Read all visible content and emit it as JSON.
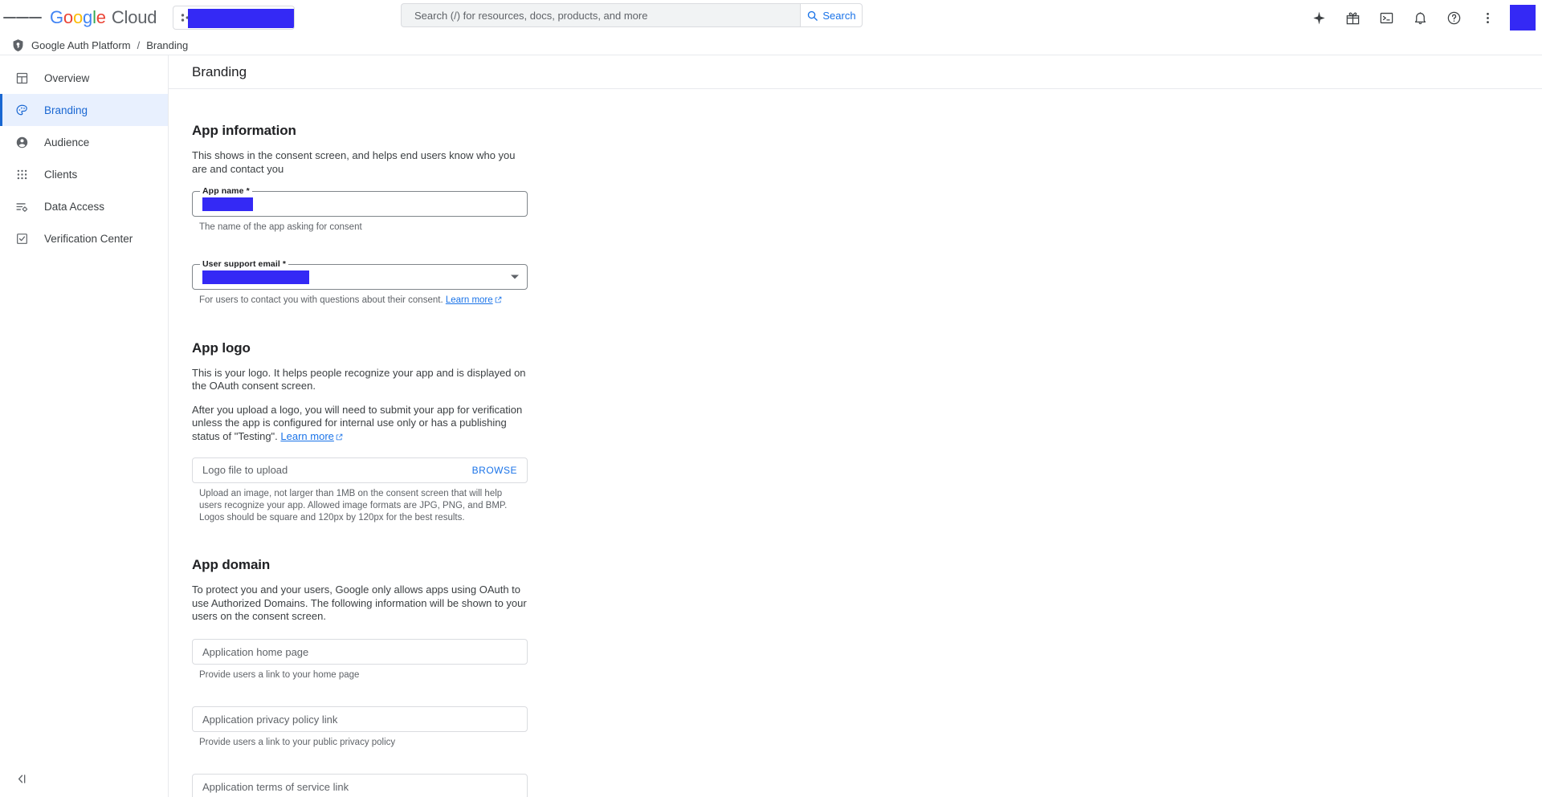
{
  "topbar": {
    "menu_icon": "hamburger-menu-icon",
    "brand": {
      "google": "Google",
      "cloud": "Cloud"
    },
    "project_selector": {
      "value": "",
      "redacted": true
    },
    "search": {
      "placeholder": "Search (/) for resources, docs, products, and more",
      "value": "",
      "button_label": "Search",
      "icon": "search-icon"
    },
    "icons": [
      {
        "name": "gemini-sparkle-icon",
        "label": "Gemini"
      },
      {
        "name": "gift-icon",
        "label": "Offers"
      },
      {
        "name": "cloud-shell-terminal-icon",
        "label": "Activate Cloud Shell"
      },
      {
        "name": "notifications-bell-icon",
        "label": "Notifications"
      },
      {
        "name": "help-question-icon",
        "label": "Help"
      },
      {
        "name": "more-vert-icon",
        "label": "More options"
      }
    ],
    "avatar": {
      "name": "account-avatar",
      "redacted": true
    }
  },
  "breadcrumb": {
    "icon": "shield-key-icon",
    "product": "Google Auth Platform",
    "separator": "/",
    "current": "Branding"
  },
  "sidebar": {
    "items": [
      {
        "label": "Overview",
        "icon": "dashboard-icon",
        "active": false
      },
      {
        "label": "Branding",
        "icon": "palette-icon",
        "active": true
      },
      {
        "label": "Audience",
        "icon": "account-circle-icon",
        "active": false
      },
      {
        "label": "Clients",
        "icon": "apps-grid-icon",
        "active": false
      },
      {
        "label": "Data Access",
        "icon": "data-access-settings-icon",
        "active": false
      },
      {
        "label": "Verification Center",
        "icon": "check-box-icon",
        "active": false
      }
    ],
    "collapse_icon": "collapse-panel-icon"
  },
  "page": {
    "title": "Branding"
  },
  "sections": {
    "app_information": {
      "title": "App information",
      "description": "This shows in the consent screen, and helps end users know who you are and contact you",
      "app_name": {
        "label": "App name *",
        "value": "",
        "redacted": true,
        "helper": "The name of the app asking for consent"
      },
      "user_support_email": {
        "label": "User support email *",
        "value": "",
        "redacted": true,
        "helper_text": "For users to contact you with questions about their consent.",
        "helper_link": "Learn more",
        "dropdown_icon": "chevron-down-icon"
      }
    },
    "app_logo": {
      "title": "App logo",
      "description_line1": "This is your logo. It helps people recognize your app and is displayed on the OAuth consent screen.",
      "description_line2": "After you upload a logo, you will need to submit your app for verification unless the app is configured for internal use only or has a publishing status of \"Testing\".",
      "description_link": "Learn more",
      "upload_field": {
        "placeholder": "Logo file to upload",
        "value": "",
        "browse_label": "BROWSE"
      },
      "helper": "Upload an image, not larger than 1MB on the consent screen that will help users recognize your app. Allowed image formats are JPG, PNG, and BMP. Logos should be square and 120px by 120px for the best results."
    },
    "app_domain": {
      "title": "App domain",
      "description": "To protect you and your users, Google only allows apps using OAuth to use Authorized Domains. The following information will be shown to your users on the consent screen.",
      "fields": [
        {
          "placeholder": "Application home page",
          "value": "",
          "helper": "Provide users a link to your home page"
        },
        {
          "placeholder": "Application privacy policy link",
          "value": "",
          "helper": "Provide users a link to your public privacy policy"
        },
        {
          "placeholder": "Application terms of service link",
          "value": "",
          "helper": ""
        }
      ]
    }
  },
  "colors": {
    "accent_blue": "#1a73e8",
    "active_nav_bg": "#e8f0fe",
    "active_nav_text": "#1967d2",
    "redaction": "#3429f5",
    "text_primary": "#202124",
    "text_secondary": "#5f6368",
    "border": "#dadce0"
  }
}
